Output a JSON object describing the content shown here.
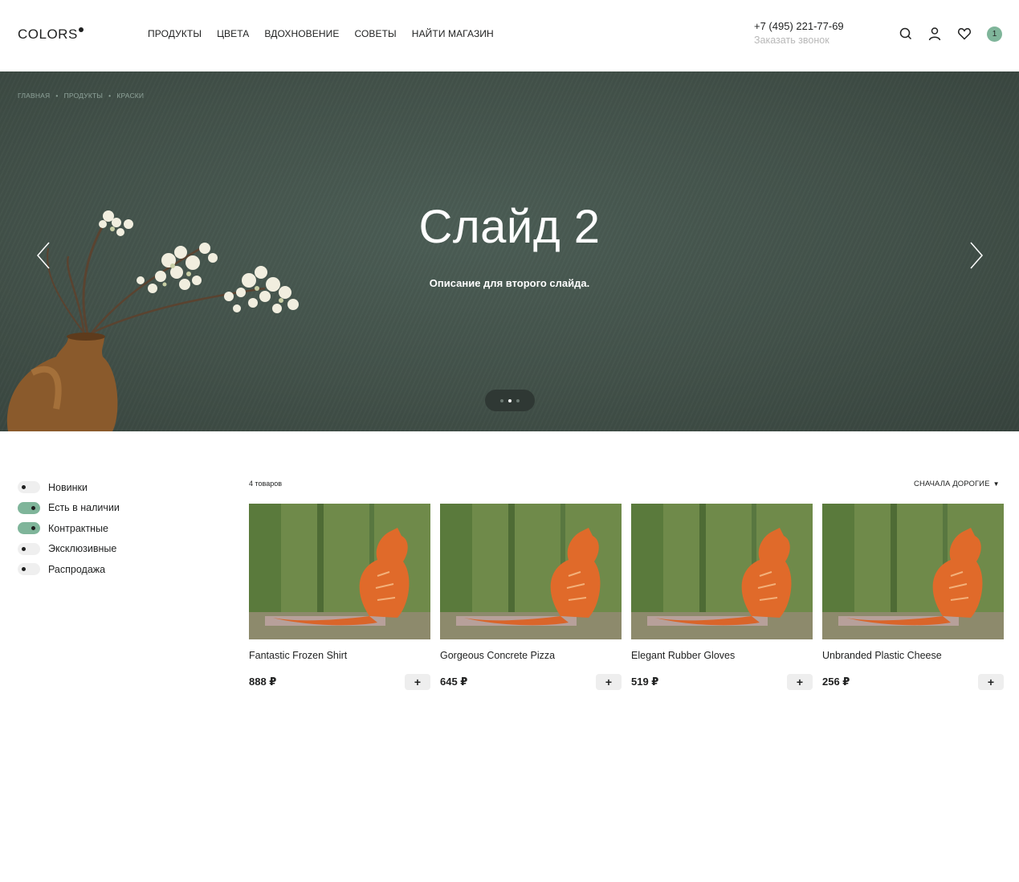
{
  "header": {
    "logo": "COLORS",
    "nav": [
      "ПРОДУКТЫ",
      "ЦВЕТА",
      "ВДОХНОВЕНИЕ",
      "СОВЕТЫ",
      "НАЙТИ МАГАЗИН"
    ],
    "phone": "+7 (495) 221-77-69",
    "callback": "Заказать звонок",
    "cart_count": "1",
    "icons": [
      "search-icon",
      "user-icon",
      "heart-icon",
      "cart-badge"
    ],
    "accent_color": "#7fb59a"
  },
  "hero": {
    "breadcrumb": [
      "ГЛАВНАЯ",
      "ПРОДУКТЫ",
      "КРАСКИ"
    ],
    "title": "Слайд 2",
    "description": "Описание для второго слайда.",
    "slides_total": 3,
    "active_slide": 2,
    "icons": [
      "arrow-left-icon",
      "arrow-right-icon"
    ]
  },
  "filters": [
    {
      "label": "Новинки",
      "on": false
    },
    {
      "label": "Есть в наличии",
      "on": true
    },
    {
      "label": "Контрактные",
      "on": true
    },
    {
      "label": "Эксклюзивные",
      "on": false
    },
    {
      "label": "Распродажа",
      "on": false
    }
  ],
  "catalog": {
    "count_label": "4 товаров",
    "sort_label": "СНАЧАЛА ДОРОГИЕ",
    "products": [
      {
        "name": "Fantastic Frozen Shirt",
        "price": "888 ₽",
        "add": "+"
      },
      {
        "name": "Gorgeous Concrete Pizza",
        "price": "645 ₽",
        "add": "+"
      },
      {
        "name": "Elegant Rubber Gloves",
        "price": "519 ₽",
        "add": "+"
      },
      {
        "name": "Unbranded Plastic Cheese",
        "price": "256 ₽",
        "add": "+"
      }
    ]
  }
}
